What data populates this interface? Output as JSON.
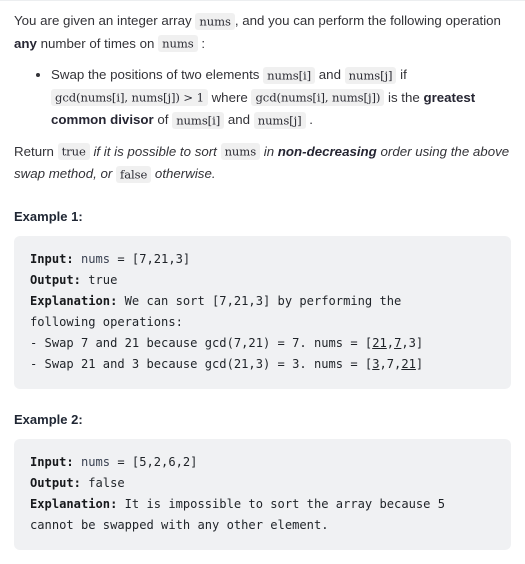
{
  "intro": {
    "seg1": "You are given an integer array ",
    "code_nums_1": "nums",
    "seg2": ", and you can perform the following operation ",
    "bold_any": "any",
    "seg3": " number of times on ",
    "code_nums_2": "nums",
    "seg4": " :"
  },
  "bullet": {
    "seg1": "Swap the positions of two elements ",
    "code_numsi_1": "nums[i]",
    "seg2": " and ",
    "code_numsj_1": "nums[j]",
    "seg3": " if ",
    "code_gcd_1": "gcd(nums[i], nums[j]) > 1",
    "seg4": " where ",
    "code_gcd_2": "gcd(nums[i], nums[j])",
    "seg5": " is the ",
    "bold_gcd": "greatest common divisor",
    "seg6": " of ",
    "code_numsi_2": "nums[i]",
    "seg7": " and ",
    "code_numsj_2": "nums[j]",
    "seg8": " ."
  },
  "return_para": {
    "lead": "Return ",
    "code_true": "true",
    "seg1": " if it is possible to sort ",
    "code_nums": "nums",
    "seg2": " in ",
    "bold_nondec": "non-decreasing",
    "seg3": " order using the above swap method, or ",
    "code_false": "false",
    "seg4": " otherwise."
  },
  "examples": [
    {
      "heading": "Example 1:",
      "input_label": "Input:",
      "input_var": " nums",
      "input_value": " = [7,21,3]",
      "output_label": "Output:",
      "output_value": " true",
      "explanation_label": "Explanation:",
      "explanation_line1": " We can sort [7,21,3] by performing the",
      "explanation_line2": "following operations:",
      "step1_pre": "- Swap 7 and 21 because gcd(7,21) = 7. nums = [",
      "step1_u1": "21",
      "step1_mid": ",",
      "step1_u2": "7",
      "step1_post": ",3]",
      "step2_pre": "- Swap 21 and 3 because gcd(21,3) = 3. nums = [",
      "step2_u1": "3",
      "step2_mid": ",7,",
      "step2_u2": "21",
      "step2_post": "]"
    },
    {
      "heading": "Example 2:",
      "input_label": "Input:",
      "input_var": " nums",
      "input_value": " = [5,2,6,2]",
      "output_label": "Output:",
      "output_value": " false",
      "explanation_label": "Explanation:",
      "explanation_line1": " It is impossible to sort the array because 5",
      "explanation_line2": "cannot be swapped with any other element."
    }
  ],
  "colors": {
    "code_block_bg": "#f0f1f3",
    "inline_code_bg": "#f0f0f0",
    "text": "#333338",
    "heading": "#1f2633"
  }
}
